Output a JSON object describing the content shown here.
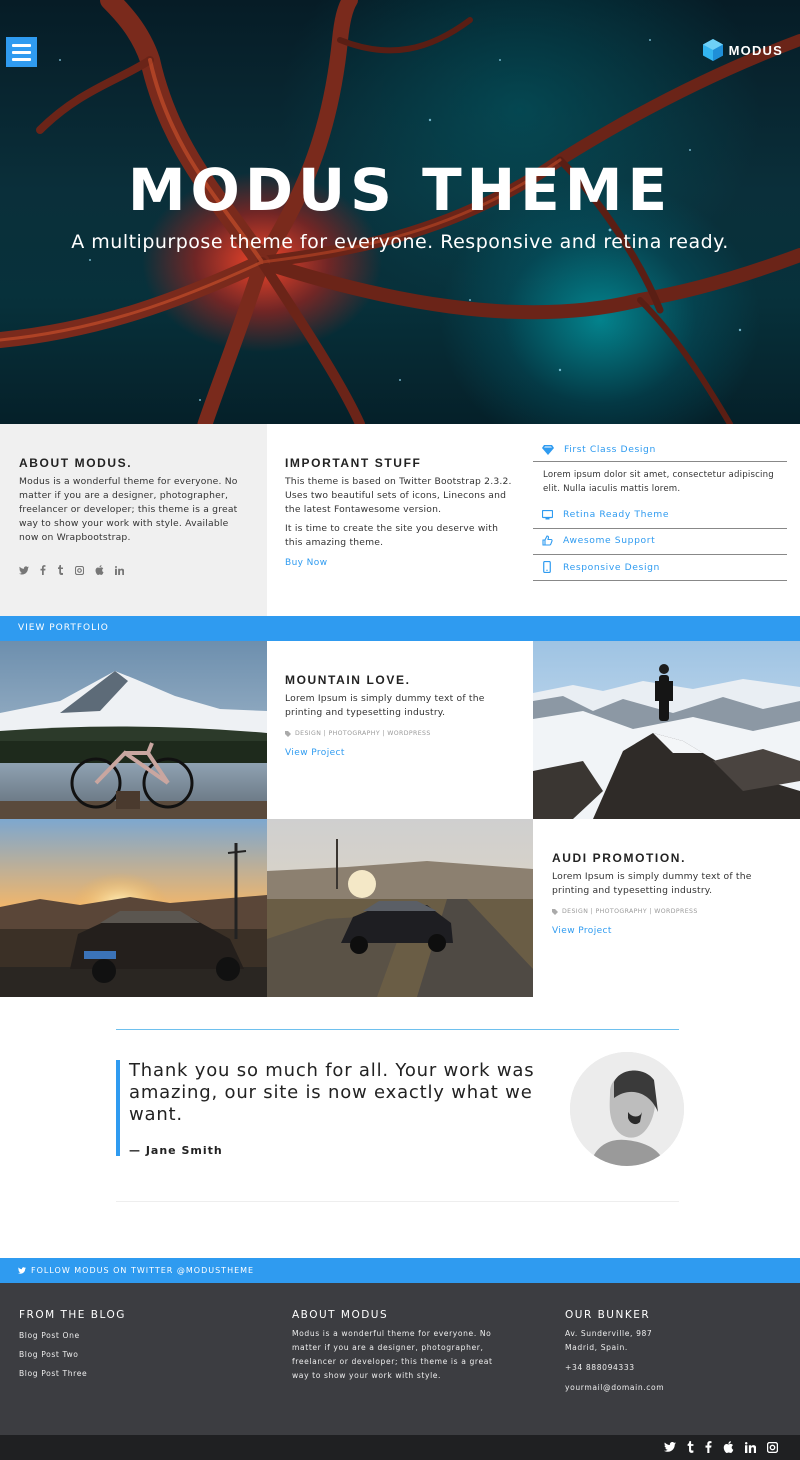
{
  "header": {
    "brand_name": "MODUS",
    "title": "MODUS THEME",
    "subtitle": "A multipurpose theme for everyone. Responsive and retina ready."
  },
  "about": {
    "heading": "ABOUT MODUS.",
    "text": "Modus is a wonderful theme for everyone. No matter if you are a designer, photographer, freelancer or developer; this theme is a great way to show your work with style. Available now on Wrapbootstrap.",
    "social_icons": [
      "twitter-icon",
      "facebook-icon",
      "tumblr-icon",
      "instagram-icon",
      "apple-icon",
      "linkedin-icon"
    ]
  },
  "stuff": {
    "heading": "IMPORTANT STUFF",
    "text1": "This theme is based on Twitter Bootstrap 2.3.2. Uses two beautiful sets of icons, Linecons and the latest Fontawesome version.",
    "text2": "It is time to create the site you deserve with this amazing theme.",
    "link": "Buy Now"
  },
  "features": {
    "items": [
      {
        "label": "First Class Design",
        "icon": "diamond-icon"
      },
      {
        "label": "Retina Ready Theme",
        "icon": "monitor-icon"
      },
      {
        "label": "Awesome Support",
        "icon": "thumbs-up-icon"
      },
      {
        "label": "Responsive Design",
        "icon": "mobile-icon"
      }
    ],
    "open_text": "Lorem ipsum dolor sit amet, consectetur adipiscing elit. Nulla iaculis mattis lorem."
  },
  "portfolio": {
    "bar_label": "VIEW PORTFOLIO",
    "cards": [
      {
        "title": "MOUNTAIN LOVE.",
        "text": "Lorem Ipsum is simply dummy text of the printing and typesetting industry.",
        "tags": "DESIGN | PHOTOGRAPHY | WORDPRESS",
        "link": "View Project"
      },
      {
        "title": "AUDI PROMOTION.",
        "text": "Lorem Ipsum is simply dummy text of the printing and typesetting industry.",
        "tags": "DESIGN | PHOTOGRAPHY | WORDPRESS",
        "link": "View Project"
      }
    ]
  },
  "testimonial": {
    "quote": "Thank you so much for all. Your work was amazing, our site is now exactly what we want.",
    "author": "— Jane Smith"
  },
  "twitter_bar": {
    "label": "FOLLOW MODUS ON TWITTER @MODUSTHEME"
  },
  "footer": {
    "blog": {
      "heading": "FROM THE BLOG",
      "posts": [
        "Blog Post One",
        "Blog Post Two",
        "Blog Post Three"
      ]
    },
    "about": {
      "heading": "ABOUT MODUS",
      "text": "Modus is a wonderful theme for everyone. No matter if you are a designer, photographer, freelancer or developer; this theme is a great way to show your work with style."
    },
    "bunker": {
      "heading": "OUR BUNKER",
      "address1": "Av. Sunderville, 987",
      "address2": "Madrid, Spain.",
      "phone": "+34 888094333",
      "email": "yourmail@domain.com"
    },
    "bottom_icons": [
      "twitter-icon",
      "tumblr-icon",
      "facebook-icon",
      "apple-icon",
      "linkedin-icon",
      "instagram-icon"
    ]
  },
  "colors": {
    "accent": "#2f9bf0",
    "footer_bg": "#3c3d41",
    "bottom_bar_bg": "#1f2022",
    "about_bg": "#f0f0f0"
  }
}
